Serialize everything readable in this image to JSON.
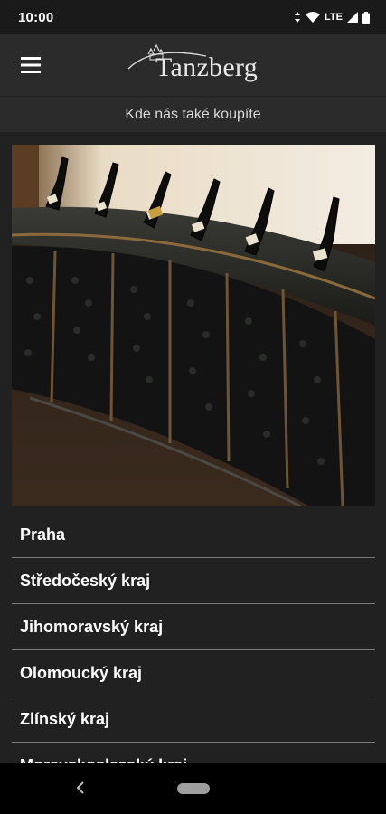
{
  "status_bar": {
    "time": "10:00",
    "network": "LTE"
  },
  "header": {
    "logo_text": "Tanzberg",
    "menu_icon": "hamburger-menu-icon"
  },
  "subtitle": "Kde nás také koupíte",
  "hero_image": {
    "description_icon": "wine-cellar-photo"
  },
  "regions": [
    "Praha",
    "Středočeský kraj",
    "Jihomoravský kraj",
    "Olomoucký kraj",
    "Zlínský kraj",
    "Moravskoslezský kraj"
  ],
  "colors": {
    "background": "#212121",
    "app_bar": "#2b2b2b",
    "divider": "#7a7a7a"
  }
}
